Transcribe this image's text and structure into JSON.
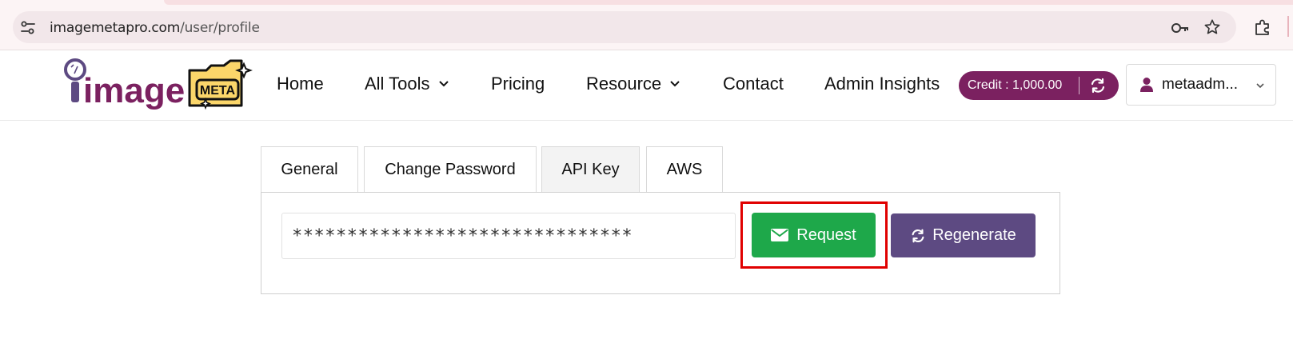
{
  "browser": {
    "url_host": "imagemetapro.com",
    "url_path": "/user/profile",
    "icons": [
      "site-info-icon",
      "key-icon",
      "star-icon",
      "extensions-icon"
    ]
  },
  "logo": {
    "text": "image",
    "badge": "META"
  },
  "nav": {
    "home": "Home",
    "all_tools": "All Tools",
    "pricing": "Pricing",
    "resource": "Resource",
    "contact": "Contact",
    "admin_insights": "Admin Insights"
  },
  "credit": {
    "label": "Credit : 1,000.00"
  },
  "user": {
    "name": "metaadm..."
  },
  "tabs": [
    {
      "label": "General"
    },
    {
      "label": "Change Password"
    },
    {
      "label": "API Key",
      "active": true
    },
    {
      "label": "AWS"
    }
  ],
  "api_key": {
    "masked_value": "*******************************",
    "request_label": "Request",
    "regenerate_label": "Regenerate"
  },
  "colors": {
    "brand_purple": "#7b2160",
    "request_green": "#1ea84a",
    "regenerate_purple": "#5d4a82",
    "highlight_red": "#e00000",
    "logo_yellow": "#fbd66a"
  }
}
